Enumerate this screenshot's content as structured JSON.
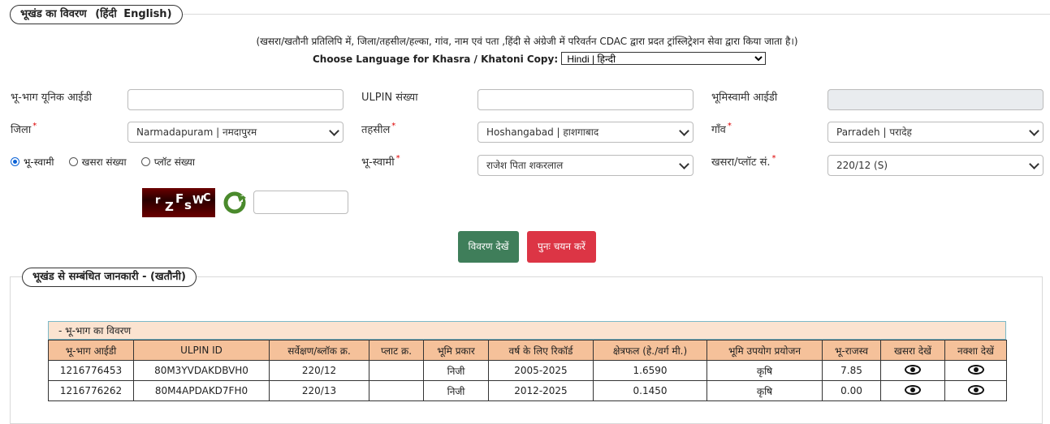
{
  "section1": {
    "legend_hi": "भूखंड का विवरण",
    "legend_opt_hi": "(हिंदी",
    "legend_opt_en": "English)",
    "note": "(खसरा/खतौनी प्रतिलिपि में, जिला/तहसील/हल्का, गांव, नाम एवं पता ,हिंदी से अंग्रेजी में परिवर्तन CDAC द्वारा प्रदत ट्रांस्लिट्रेशन सेवा द्वारा किया जाता है।)",
    "lang_label": "Choose Language for Khasra / Khatoni Copy:",
    "lang_value": "Hindi | हिन्दी"
  },
  "form": {
    "unique_id_label": "भू-भाग यूनिक आईडी",
    "ulpin_label": "ULPIN संख्या",
    "owner_id_label": "भूमिस्वामी आईडी",
    "district_label": "जिला",
    "district_value": "Narmadapuram | नमदापुरम",
    "tehsil_label": "तहसील",
    "tehsil_value": "Hoshangabad | हाशगाबाद",
    "village_label": "गाँव",
    "village_value": "Parradeh | परादेह",
    "radio_owner": "भू-स्वामी",
    "radio_khasra": "खसरा संख्या",
    "radio_plot": "प्लॉट संख्या",
    "owner_label": "भू-स्वामी",
    "owner_value": "राजेश पिता शकरलाल",
    "khasra_label": "खसरा/प्लॉट सं.",
    "khasra_value": "220/12 (S)",
    "required_mark": "*",
    "captcha_chars": [
      "r",
      "Z",
      "F",
      "s",
      "W",
      "C"
    ]
  },
  "buttons": {
    "view": "विवरण देखें",
    "reset": "पुनः चयन करें"
  },
  "section2": {
    "legend": "भूखंड से सम्बंधित जानकारी -   (खतौनी)",
    "caption": "- भू-भाग का विवरण",
    "headers": [
      "भू-भाग आईडी",
      "ULPIN ID",
      "सर्वेक्षण/ब्लॉक क्र.",
      "प्लाट क्र.",
      "भूमि प्रकार",
      "वर्ष के लिए रिकॉर्ड",
      "क्षेत्रफल (हे./वर्ग मी.)",
      "भूमि उपयोग प्रयोजन",
      "भू-राजस्व",
      "खसरा देखें",
      "नक्शा देखें"
    ],
    "rows": [
      [
        "1216776453",
        "80M3YVDAKDBVH0",
        "220/12",
        "",
        "निजी",
        "2005-2025",
        "1.6590",
        "कृषि",
        "7.85"
      ],
      [
        "1216776262",
        "80M4APDAKD7FH0",
        "220/13",
        "",
        "निजी",
        "2012-2025",
        "0.1450",
        "कृषि",
        "0.00"
      ]
    ]
  },
  "colors": {
    "view_button": "#3f7e5a",
    "reset_button": "#dc3545",
    "table_header": "#f5c19a",
    "caption_bg": "#fbe3d0"
  }
}
